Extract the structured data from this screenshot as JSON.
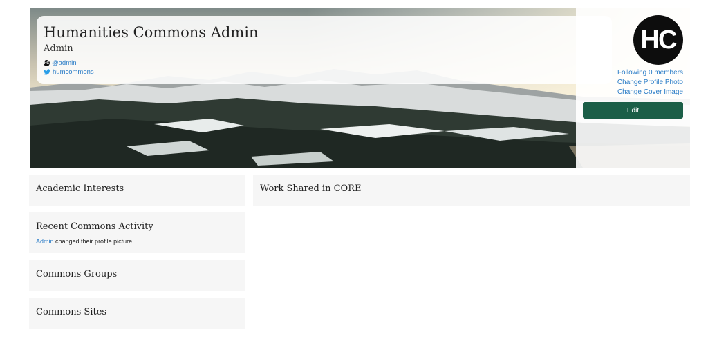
{
  "profile": {
    "display_name": "Humanities Commons Admin",
    "role": "Admin",
    "handle": "@admin",
    "twitter": "humcommons",
    "avatar_text": "HC"
  },
  "sidebar_actions": {
    "following": "Following 0 members",
    "change_photo": "Change Profile Photo",
    "change_cover": "Change Cover Image",
    "edit_label": "Edit"
  },
  "sections": {
    "academic_interests": "Academic Interests",
    "recent_activity": "Recent Commons Activity",
    "activity_user": "Admin",
    "activity_text": " changed their profile picture",
    "groups": "Commons Groups",
    "sites": "Commons Sites",
    "core_work": "Work Shared in CORE"
  },
  "colors": {
    "link": "#2a7cc7",
    "edit_button": "#1b5e47",
    "panel_bg": "#f6f6f6"
  },
  "icons": [
    "hc-icon",
    "twitter-icon"
  ]
}
